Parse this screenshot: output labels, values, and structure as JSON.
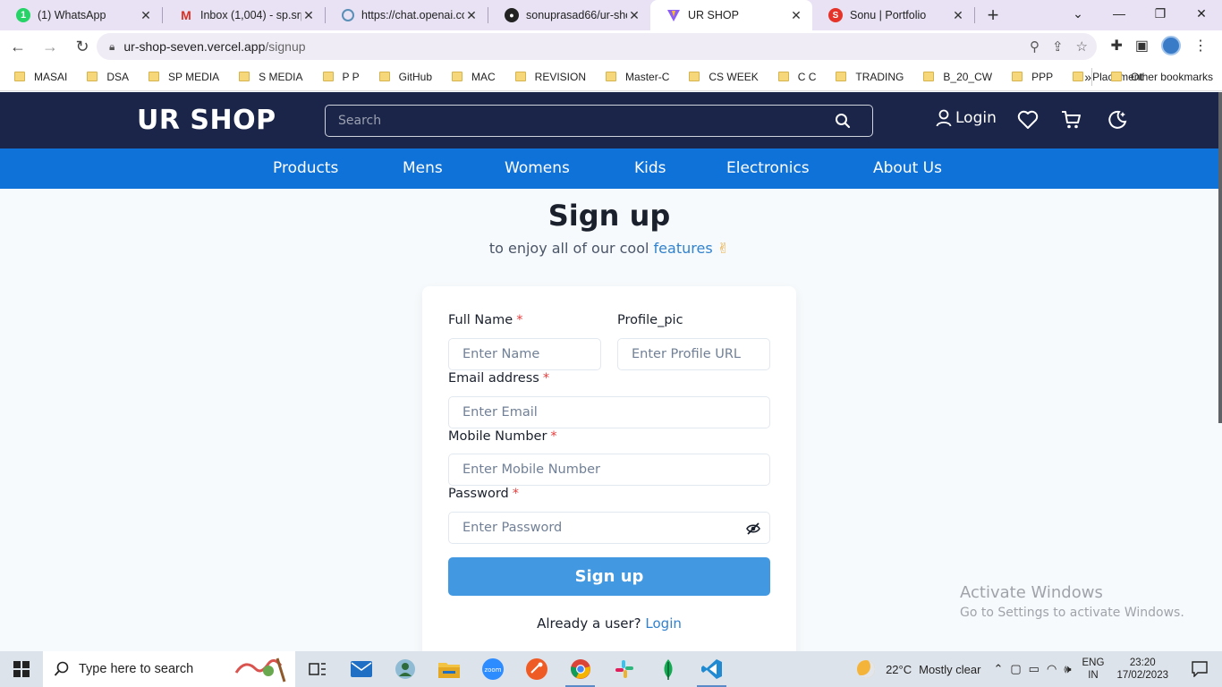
{
  "browser": {
    "tabs": [
      {
        "title": "(1) WhatsApp",
        "icon": "whatsapp-icon",
        "color": "#25d366"
      },
      {
        "title": "Inbox (1,004) - sp.srp1",
        "icon": "gmail-icon",
        "color": "#d93025"
      },
      {
        "title": "https://chat.openai.co",
        "icon": "openai-icon",
        "color": "#5a8fb8"
      },
      {
        "title": "sonuprasad66/ur-shop",
        "icon": "github-icon",
        "color": "#222222"
      },
      {
        "title": "UR SHOP",
        "icon": "vite-icon",
        "color": "#8b5cf6"
      },
      {
        "title": "Sonu | Portfolio",
        "icon": "portfolio-icon",
        "color": "#e5332a"
      }
    ],
    "url_host": "ur-shop-seven.vercel.app",
    "url_path": "/signup",
    "bookmarks": [
      "MASAI",
      "DSA",
      "SP MEDIA",
      "S MEDIA",
      "P P",
      "GitHub",
      "MAC",
      "REVISION",
      "Master-C",
      "CS WEEK",
      "C C",
      "TRADING",
      "B_20_CW",
      "PPP",
      "Placement"
    ],
    "bookmarks_more": "»",
    "other_bookmarks": "Other bookmarks"
  },
  "site": {
    "logo": "UR SHOP",
    "search_placeholder": "Search",
    "login": "Login",
    "nav": [
      "Products",
      "Mens",
      "Womens",
      "Kids",
      "Electronics",
      "About Us"
    ],
    "colors": {
      "header": "#1a2549",
      "nav": "#0f72d9",
      "accent": "#4299e1"
    }
  },
  "form": {
    "title": "Sign up",
    "subtitle_prefix": "to enjoy all of our cool",
    "subtitle_highlight": "features",
    "subtitle_emoji": "✌",
    "full_name_label": "Full Name",
    "full_name_placeholder": "Enter Name",
    "profile_label": "Profile_pic",
    "profile_placeholder": "Enter Profile URL",
    "email_label": "Email address",
    "email_placeholder": "Enter Email",
    "mobile_label": "Mobile Number",
    "mobile_placeholder": "Enter Mobile Number",
    "password_label": "Password",
    "password_placeholder": "Enter Password",
    "required_mark": "*",
    "submit": "Sign up",
    "already_text": "Already a user?",
    "login_link": "Login"
  },
  "watermark": {
    "line1": "Activate Windows",
    "line2": "Go to Settings to activate Windows."
  },
  "taskbar": {
    "search_placeholder": "Type here to search",
    "weather_temp": "22°C",
    "weather_desc": "Mostly clear",
    "lang_line1": "ENG",
    "lang_line2": "IN",
    "time": "23:20",
    "date": "17/02/2023"
  }
}
